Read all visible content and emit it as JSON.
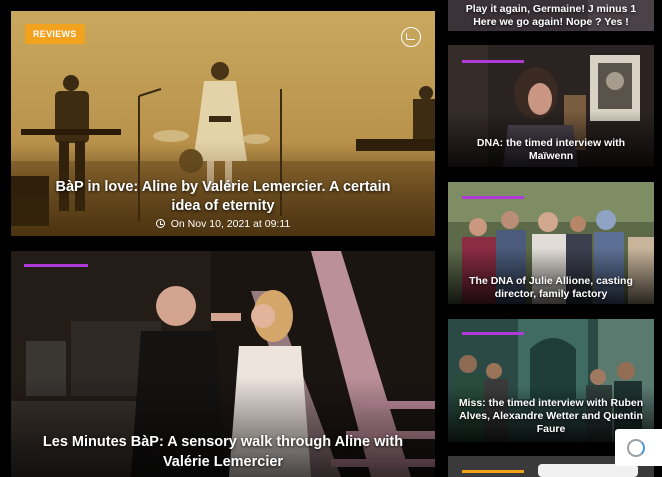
{
  "hero": {
    "badge": "REVIEWS",
    "title": "BàP in love: Aline by Valérie Lemercier. A certain idea of eternity",
    "date": "On Nov 10, 2021 at 09:11",
    "colors": {
      "badge": "#f3a21d",
      "tint": "#c8a04a"
    }
  },
  "feature": {
    "title": "Les Minutes BàP: A sensory walk through Aline with Valérie Lemercier"
  },
  "sidebar": [
    {
      "title": "Play it again, Germaine! J minus 1 Here we go again! Nope ? Yes !"
    },
    {
      "title": "DNA: the timed interview with Maïwenn"
    },
    {
      "title": "The DNA of Julie Allione, casting director, family factory"
    },
    {
      "title": "Miss: the timed interview with Ruben Alves, Alexandre Wetter and Quentin Faure"
    },
    {
      "title": ""
    }
  ],
  "accent_color": "#b03ad8"
}
